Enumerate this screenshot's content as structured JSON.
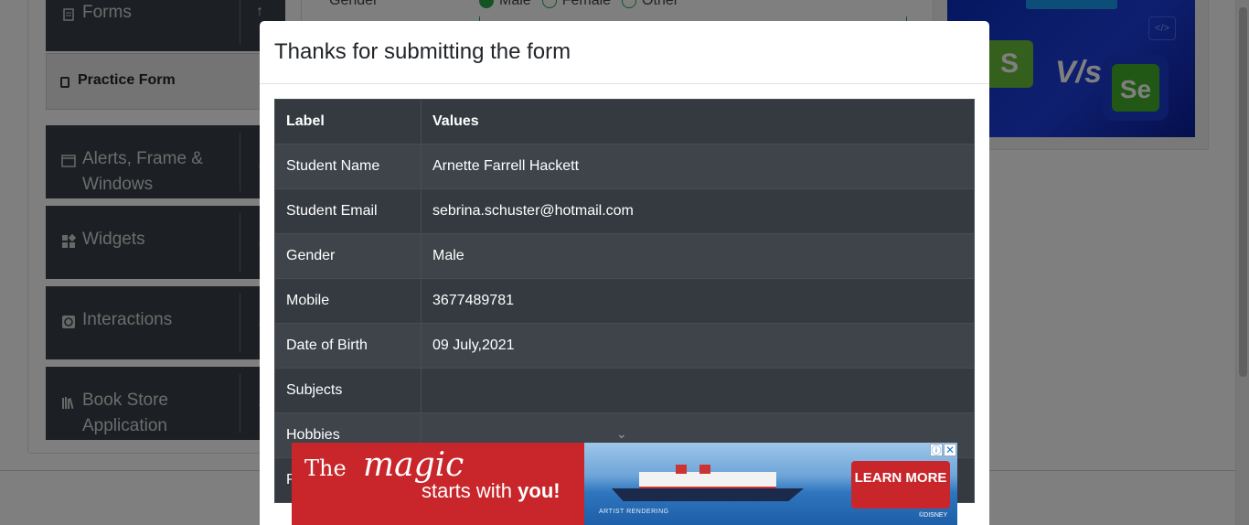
{
  "sidebar": {
    "forms": {
      "label": "Forms",
      "icon": "forms-icon"
    },
    "practice_form": {
      "label": "Practice Form",
      "icon": "form-file-icon"
    },
    "alerts": {
      "label_line1": "Alerts, Frame &",
      "label_line2": "Windows",
      "icon": "window-icon"
    },
    "widgets": {
      "label": "Widgets",
      "icon": "widgets-icon"
    },
    "interactions": {
      "label": "Interactions",
      "icon": "interactions-icon"
    },
    "book_store": {
      "label_line1": "Book Store",
      "label_line2": "Application",
      "icon": "books-icon"
    }
  },
  "background_form": {
    "gender_label": "Gender",
    "gender_options": [
      "Male",
      "Female",
      "Other"
    ]
  },
  "banner": {
    "left_text": "S",
    "vs_text": "V/s",
    "right_text": "Se",
    "code_text": "</>"
  },
  "modal": {
    "title": "Thanks for submitting the form",
    "columns": {
      "label": "Label",
      "values": "Values"
    },
    "rows": [
      {
        "label": "Student Name",
        "value": "Arnette Farrell Hackett"
      },
      {
        "label": "Student Email",
        "value": "sebrina.schuster@hotmail.com"
      },
      {
        "label": "Gender",
        "value": "Male"
      },
      {
        "label": "Mobile",
        "value": "3677489781"
      },
      {
        "label": "Date of Birth",
        "value": "09 July,2021"
      },
      {
        "label": "Subjects",
        "value": ""
      },
      {
        "label": "Hobbies",
        "value": ""
      }
    ],
    "peek_label": "P"
  },
  "ad": {
    "the": "The",
    "magic": "magic",
    "starts": "starts with",
    "you": "you!",
    "cta": "LEARN MORE",
    "artist": "ARTIST RENDERING",
    "brand": "©DISNEY"
  },
  "colors": {
    "modal_table_dark": "#343a40",
    "sidebar_dark": "#393e46",
    "accent_green": "#28a745",
    "ad_red": "#c8262b"
  }
}
